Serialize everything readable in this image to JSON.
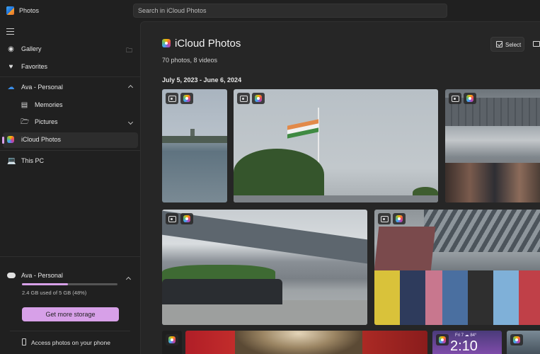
{
  "app": {
    "title": "Photos"
  },
  "search": {
    "placeholder": "Search in iCloud Photos"
  },
  "sidebar": {
    "items": [
      {
        "label": "Gallery"
      },
      {
        "label": "Favorites"
      },
      {
        "label": "Ava - Personal"
      },
      {
        "label": "Memories"
      },
      {
        "label": "Pictures"
      },
      {
        "label": "iCloud Photos"
      },
      {
        "label": "This PC"
      }
    ],
    "storage": {
      "account": "Ava - Personal",
      "used_text": "2.4 GB used of 5 GB (48%)",
      "used_fraction": 0.48,
      "button": "Get more storage",
      "phone_link": "Access photos on your phone"
    }
  },
  "main": {
    "title": "iCloud Photos",
    "subtitle": "70 photos, 8 videos",
    "select_label": "Select",
    "date_range": "July 5, 2023 - June 6, 2024"
  },
  "lock_screen": {
    "date": "Fri 7  ☁ 84°",
    "time": "2:10"
  },
  "colors": {
    "accent": "#d7a0e8",
    "background": "#202020",
    "main_background": "#262626"
  },
  "icons": [
    "gallery-icon",
    "add-folder-icon",
    "heart-icon",
    "cloud-icon",
    "memories-icon",
    "folder-icon",
    "icloud-photos-icon",
    "pc-icon",
    "select-icon",
    "slideshow-icon",
    "camera-badge-icon",
    "icloud-badge-icon",
    "phone-icon"
  ]
}
